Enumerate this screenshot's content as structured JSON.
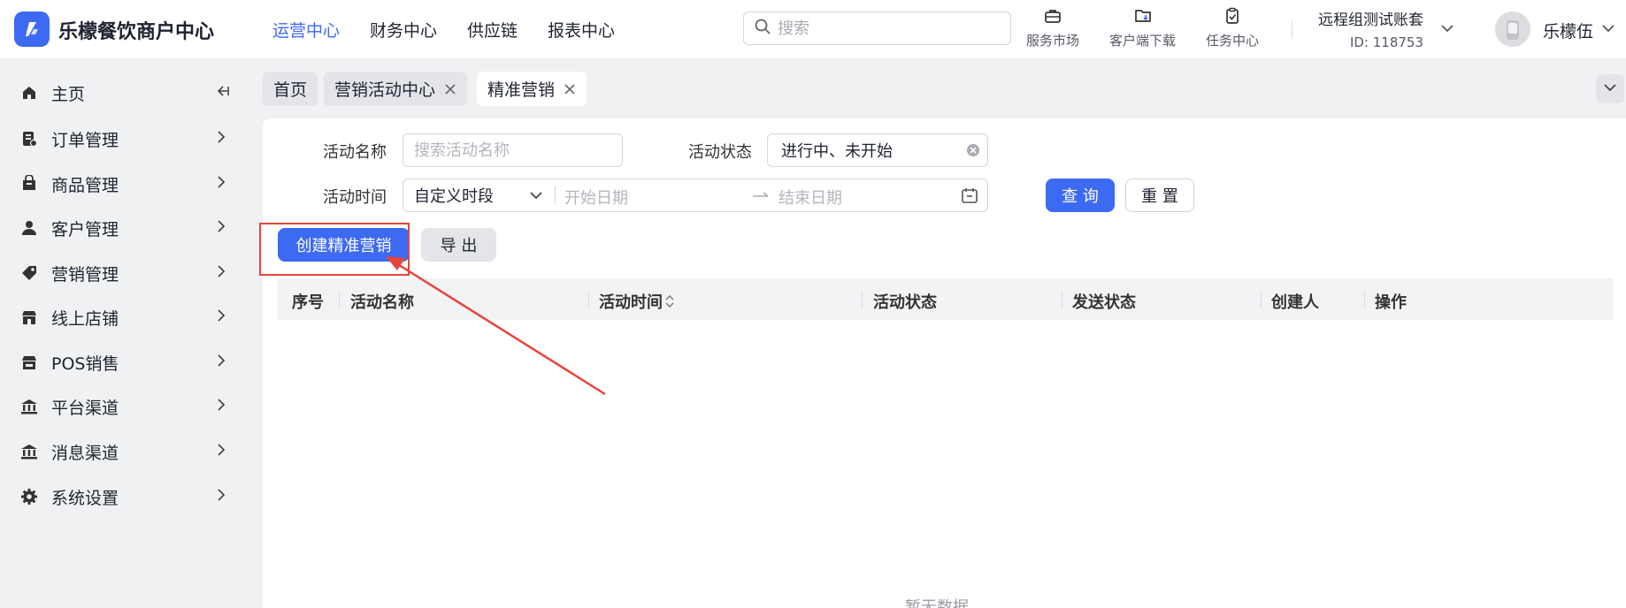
{
  "header": {
    "brand_name": "乐檬餐饮商户中心",
    "nav": [
      {
        "label": "运营中心",
        "active": true
      },
      {
        "label": "财务中心",
        "active": false
      },
      {
        "label": "供应链",
        "active": false
      },
      {
        "label": "报表中心",
        "active": false
      }
    ],
    "search_placeholder": "搜索",
    "tools": [
      {
        "label": "服务市场",
        "icon": "briefcase-icon"
      },
      {
        "label": "客户端下载",
        "icon": "folder-download-icon"
      },
      {
        "label": "任务中心",
        "icon": "clipboard-check-icon"
      }
    ],
    "account_name": "远程组测试账套",
    "account_id": "ID: 118753",
    "user_name": "乐檬伍"
  },
  "sidebar": {
    "items": [
      {
        "label": "主页",
        "icon": "home-icon"
      },
      {
        "label": "订单管理",
        "icon": "order-icon"
      },
      {
        "label": "商品管理",
        "icon": "product-icon"
      },
      {
        "label": "客户管理",
        "icon": "user-icon"
      },
      {
        "label": "营销管理",
        "icon": "tag-icon"
      },
      {
        "label": "线上店铺",
        "icon": "store-icon"
      },
      {
        "label": "POS销售",
        "icon": "pos-store-icon"
      },
      {
        "label": "平台渠道",
        "icon": "bank-icon"
      },
      {
        "label": "消息渠道",
        "icon": "message-bank-icon"
      },
      {
        "label": "系统设置",
        "icon": "gear-icon"
      }
    ]
  },
  "tabs": [
    {
      "label": "首页",
      "closable": false,
      "active": false
    },
    {
      "label": "营销活动中心",
      "closable": true,
      "active": false
    },
    {
      "label": "精准营销",
      "closable": true,
      "active": true
    }
  ],
  "filters": {
    "name_label": "活动名称",
    "name_placeholder": "搜索活动名称",
    "status_label": "活动状态",
    "status_value": "进行中、未开始",
    "time_label": "活动时间",
    "time_mode": "自定义时段",
    "start_placeholder": "开始日期",
    "end_placeholder": "结束日期",
    "query_button": "查 询",
    "reset_button": "重 置"
  },
  "actions": {
    "create_button": "创建精准营销",
    "export_button": "导 出"
  },
  "table": {
    "columns": [
      "序号",
      "活动名称",
      "活动时间",
      "活动状态",
      "发送状态",
      "创建人",
      "操作"
    ],
    "empty_text": "暂无数据"
  },
  "colors": {
    "primary": "#3d6af2",
    "annotation": "#e8453c"
  }
}
